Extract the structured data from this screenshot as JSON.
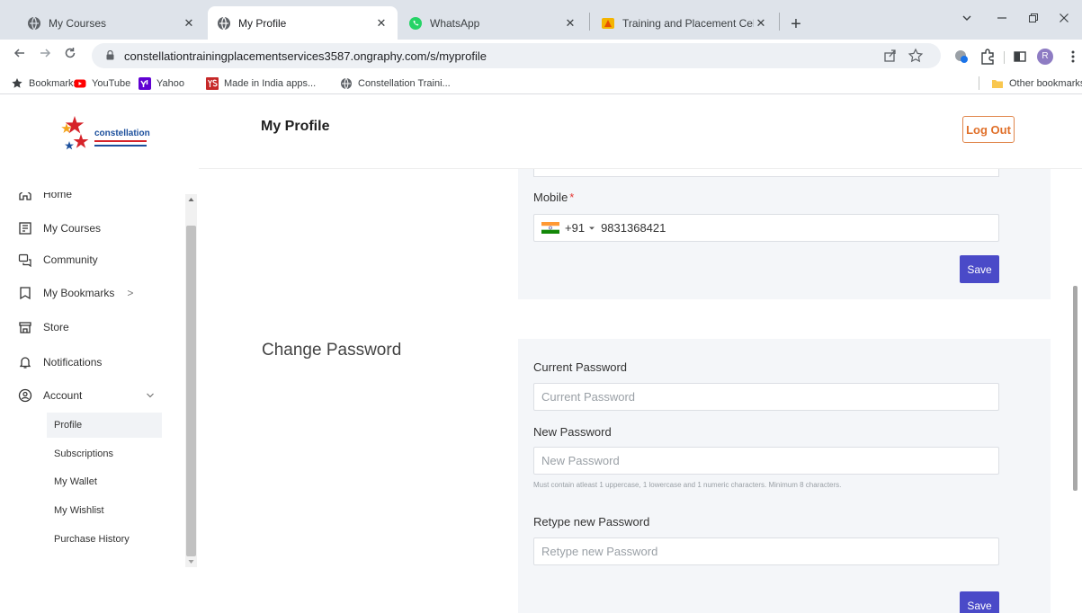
{
  "browser": {
    "tabs": [
      {
        "title": "My Courses",
        "icon": "globe-icon",
        "active": false
      },
      {
        "title": "My Profile",
        "icon": "globe-icon",
        "active": true
      },
      {
        "title": "WhatsApp",
        "icon": "whatsapp-icon",
        "active": false
      },
      {
        "title": "Training and Placement Cell",
        "icon": "training-cell-icon",
        "active": false
      }
    ],
    "close_glyph": "✕",
    "new_tab_glyph": "+",
    "url": "constellationtrainingplacementservices3587.ongraphy.com/s/myprofile",
    "profile_initial": "R"
  },
  "bookmarks": {
    "items": [
      {
        "label": "Bookmarks",
        "icon": "star-icon"
      },
      {
        "label": "YouTube",
        "icon": "youtube-icon"
      },
      {
        "label": "Yahoo",
        "icon": "yahoo-icon"
      },
      {
        "label": "Made in India apps...",
        "icon": "ys-icon"
      },
      {
        "label": "Constellation Traini...",
        "icon": "globe-icon"
      }
    ],
    "other": "Other bookmarks"
  },
  "sidebar": {
    "logo_text": "constellation",
    "items": [
      {
        "label": "Home",
        "icon": "home-icon"
      },
      {
        "label": "My Courses",
        "icon": "courses-icon"
      },
      {
        "label": "Community",
        "icon": "community-icon"
      },
      {
        "label": "My Bookmarks",
        "icon": "bookmark-icon",
        "suffix": ">"
      },
      {
        "label": "Store",
        "icon": "store-icon"
      },
      {
        "label": "Notifications",
        "icon": "bell-icon"
      },
      {
        "label": "Account",
        "icon": "account-icon"
      }
    ],
    "account_sub": [
      {
        "label": "Profile",
        "active": true
      },
      {
        "label": "Subscriptions",
        "active": false
      },
      {
        "label": "My Wallet",
        "active": false
      },
      {
        "label": "My Wishlist",
        "active": false
      },
      {
        "label": "Purchase History",
        "active": false
      }
    ]
  },
  "header": {
    "title": "My Profile",
    "logout_label": "Log Out"
  },
  "mobile": {
    "label": "Mobile",
    "required_mark": "*",
    "country_code": "+91",
    "number": "9831368421",
    "save_label": "Save"
  },
  "password": {
    "section_title": "Change Password",
    "current_label": "Current Password",
    "current_placeholder": "Current Password",
    "new_label": "New Password",
    "new_placeholder": "New Password",
    "hint": "Must contain atleast 1 uppercase, 1 lowercase and 1 numeric characters. Minimum 8 characters.",
    "retype_label": "Retype new Password",
    "retype_placeholder": "Retype new Password",
    "save_label": "Save"
  },
  "colors": {
    "accent": "#4a4ac8",
    "logout": "#e0702a",
    "panel": "#f4f6f9"
  }
}
